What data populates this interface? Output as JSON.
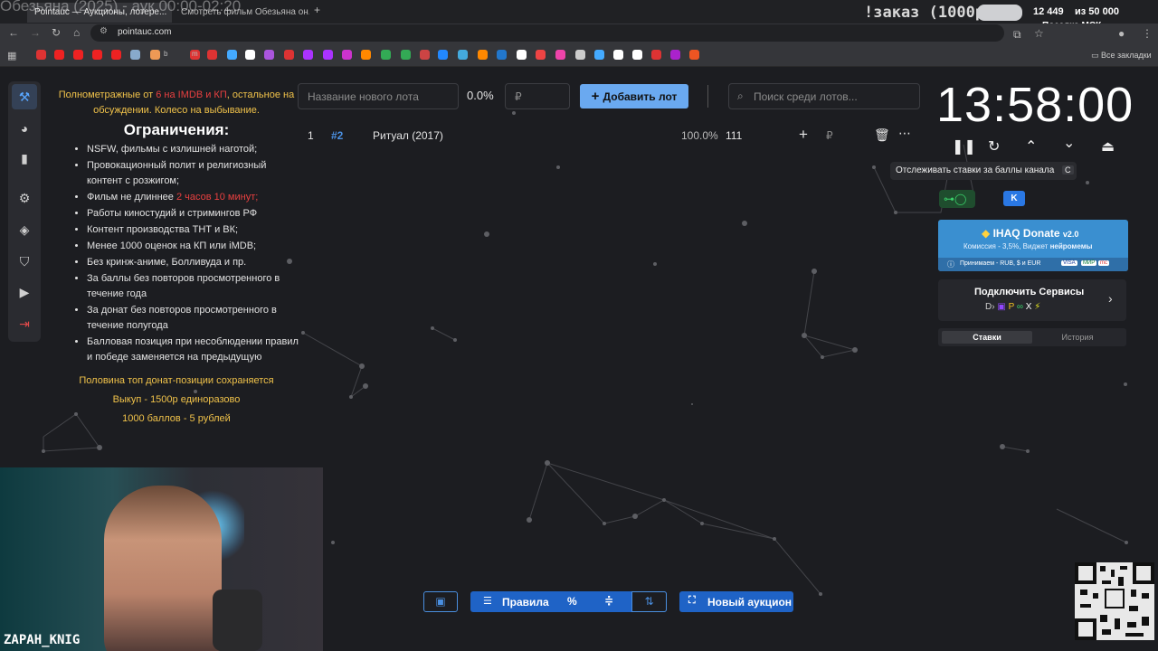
{
  "browser": {
    "tabs": [
      "Pointauc — Аукционы, лотере...",
      "Смотреть фильм Обезьяна он..."
    ],
    "url": "pointauc.com",
    "overlay_title": "Обезьяна (2025) - аук 00:00-02:20",
    "bookmark_b": "b",
    "bookmark_m": "m",
    "all_bookmarks": "Все закладки"
  },
  "stream": {
    "order_text": "!заказ (1000р)",
    "counter": "12 449",
    "counter_of": "из 50 000",
    "goal": "Поездка МСК",
    "streamer": "ZAPAH_KNIG"
  },
  "rules": {
    "line1_pre": "Полнометражные от ",
    "line1_red": "6 на IMDB и КП",
    "line1_post": ", остальное на обсуждении. Колесо на выбывание.",
    "heading": "Ограничения:",
    "items": [
      "NSFW, фильмы с излишней наготой;",
      "Провокационный полит и религиозный контент с розжигом;",
      "Фильм не длиннее ",
      "Работы киностудий и стримингов РФ",
      "Контент производства ТНТ и ВК;",
      "Менее 1000 оценок на КП или iMDB;",
      "Без кринж-аниме, Болливуда и пр.",
      "За баллы без повторов просмотренного в течение года",
      "За донат без повторов просмотренного в течение полугода",
      "Балловая позиция при несоблюдении правил и победе заменяется на предыдущую"
    ],
    "item3_red": "2 часов 10 минут;",
    "footer1": "Половина топ донат-позиции сохраняется",
    "footer2": "Выкуп - 1500р единоразово",
    "footer3": "1000 баллов - 5 рублей"
  },
  "lot_form": {
    "name_placeholder": "Название нового лота",
    "percent": "0.0%",
    "amount_placeholder": "₽",
    "add_button": "Добавить лот",
    "search_placeholder": "Поиск среди лотов..."
  },
  "lots": [
    {
      "index": "1",
      "id": "#2",
      "name": "Ритуал (2017)",
      "percent": "100.0%",
      "amount": "111",
      "currency": "₽"
    }
  ],
  "timer": {
    "value": "13:58:00"
  },
  "tooltip": {
    "text": "Отслеживать ставки за баллы канала",
    "key": "C"
  },
  "donate": {
    "title": "IHAQ Donate",
    "version": "v2.0",
    "commission": "Комиссия - 3,5%, Виджет ",
    "commission_bold": "нейромемы",
    "accepts": "Принимаем - RUB, $ и EUR",
    "cards": [
      "VISA",
      "МИР",
      "mc"
    ]
  },
  "services": {
    "title": "Подключить Сервисы"
  },
  "tabs": [
    "Ставки",
    "История"
  ],
  "bottom": {
    "rules_button": "Правила",
    "new_auction": "Новый аукцион"
  },
  "colors": {
    "accent": "#6aa9f0",
    "donate": "#3a8fd0",
    "warning": "#f0c24a",
    "danger": "#e84040"
  }
}
